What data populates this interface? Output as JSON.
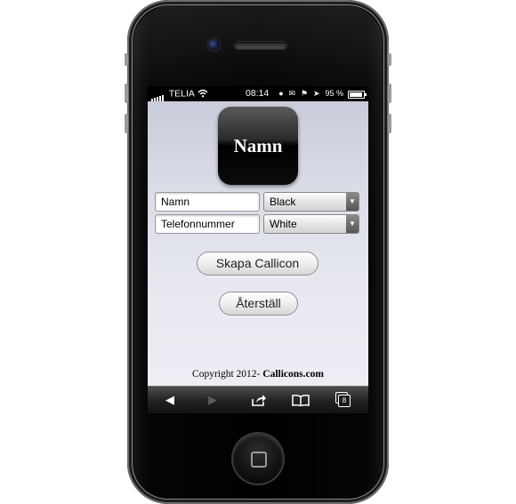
{
  "statusbar": {
    "carrier": "TELIA",
    "time": "08:14",
    "battery_percent": "95 %"
  },
  "app_icon": {
    "label": "Namn"
  },
  "form": {
    "name_field": "Namn",
    "phone_field": "Telefonnummer",
    "color_select_1": "Black",
    "color_select_2": "White"
  },
  "buttons": {
    "create": "Skapa Callicon",
    "reset": "Återställ"
  },
  "footer": {
    "copyright_prefix": "Copyright 2012- ",
    "copyright_brand": "Callicons.com"
  },
  "toolbar": {
    "back_icon": "back-arrow-icon",
    "forward_icon": "forward-arrow-icon",
    "share_icon": "share-icon",
    "bookmarks_icon": "bookmarks-icon",
    "tabs_icon": "tabs-icon",
    "tabs_count": "8"
  }
}
